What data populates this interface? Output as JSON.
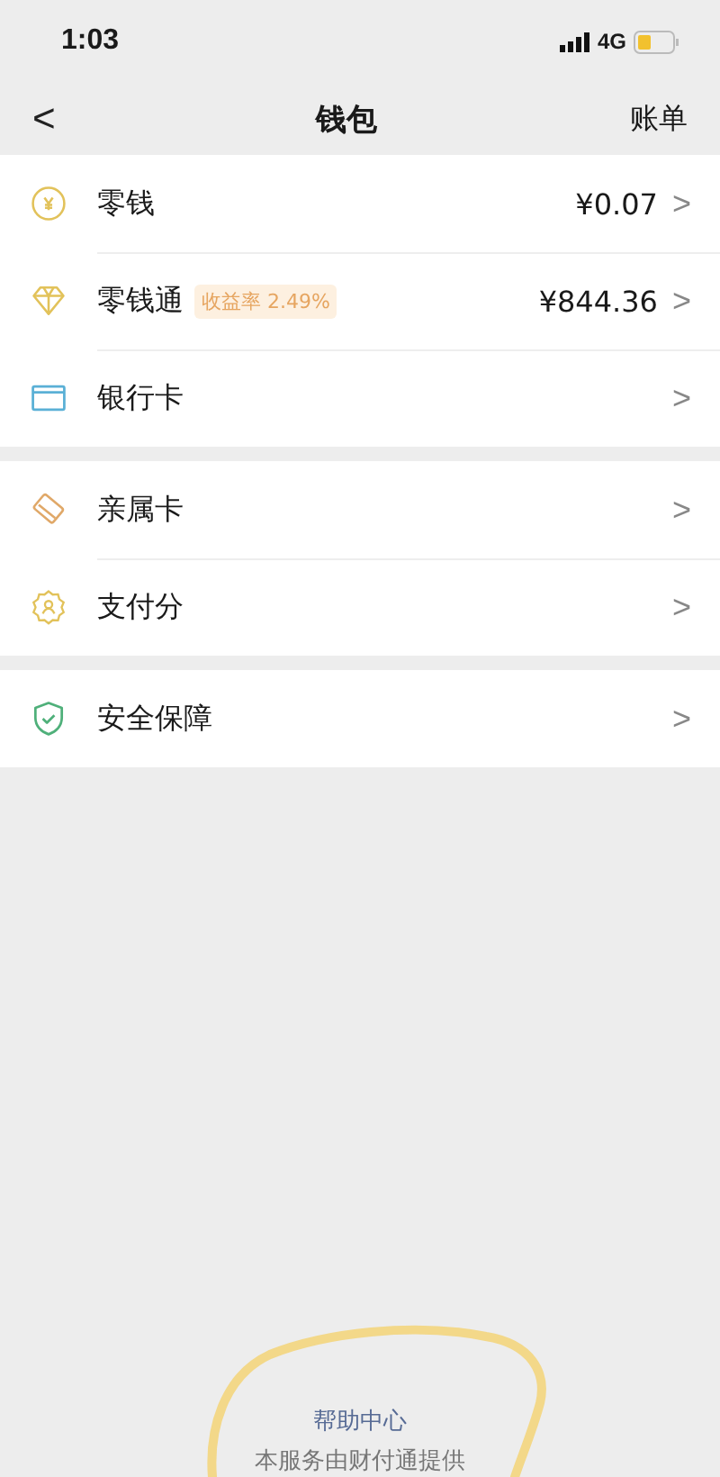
{
  "status_bar": {
    "time": "1:03",
    "network": "4G"
  },
  "nav": {
    "back": "<",
    "title": "钱包",
    "action": "账单"
  },
  "groups": [
    {
      "items": [
        {
          "kind": "coin",
          "label": "零钱",
          "value": "¥0.07",
          "chevron": ">"
        },
        {
          "kind": "diamond",
          "label": "零钱通",
          "badge": "收益率 2.49%",
          "value": "¥844.36",
          "chevron": ">"
        },
        {
          "kind": "card",
          "label": "银行卡",
          "chevron": ">"
        }
      ]
    },
    {
      "items": [
        {
          "kind": "family",
          "label": "亲属卡",
          "chevron": ">"
        },
        {
          "kind": "score",
          "label": "支付分",
          "chevron": ">"
        }
      ]
    },
    {
      "items": [
        {
          "kind": "shield",
          "label": "安全保障",
          "chevron": ">"
        }
      ]
    }
  ],
  "footer": {
    "link": "帮助中心",
    "note": "本服务由财付通提供"
  }
}
